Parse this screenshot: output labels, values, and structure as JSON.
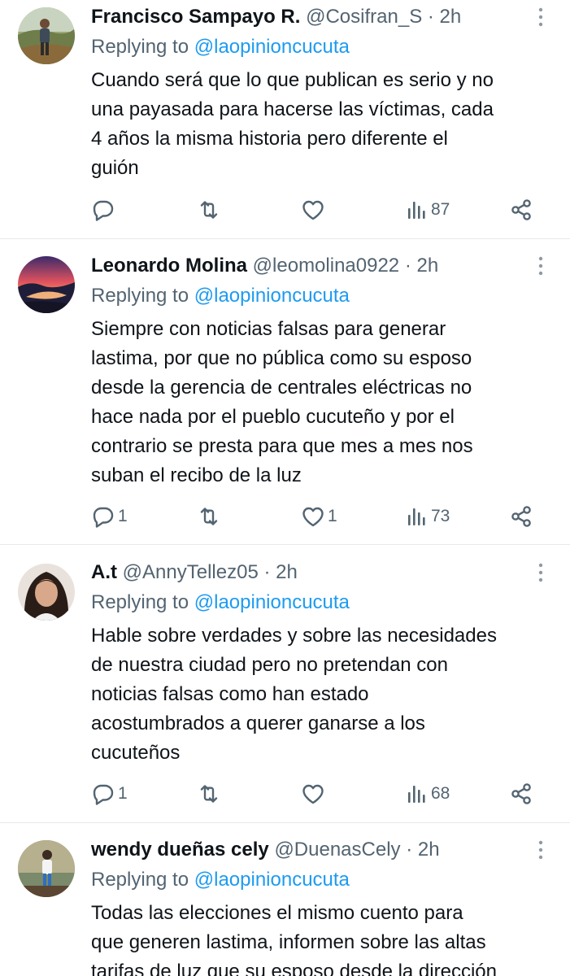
{
  "tweets": [
    {
      "name": "Francisco Sampayo R.",
      "handle": "@Cosifran_S",
      "time": "2h",
      "replying_label": "Replying to",
      "replying_to": "@laopinioncucuta",
      "lines": [
        "Cuando será que lo que publican es serio y no",
        "una payasada para hacerse las víctimas, cada",
        "4 años la misma historia pero diferente el",
        "guión"
      ],
      "reply_count": "",
      "retweet_count": "",
      "like_count": "",
      "view_count": "87",
      "avatar_icon": "profile-photo"
    },
    {
      "name": "Leonardo Molina",
      "handle": "@leomolina0922",
      "time": "2h",
      "replying_label": "Replying to",
      "replying_to": "@laopinioncucuta",
      "lines": [
        "Siempre con noticias falsas para generar",
        "lastima, por que no pública como su esposo",
        "desde la gerencia de centrales eléctricas no",
        "hace nada por el pueblo cucuteño y por el",
        "contrario se presta para que mes a  mes nos",
        "suban el recibo de la luz"
      ],
      "reply_count": "1",
      "retweet_count": "",
      "like_count": "1",
      "view_count": "73",
      "avatar_icon": "sunset-landscape-photo"
    },
    {
      "name": "A.t",
      "handle": "@AnnyTellez05",
      "time": "2h",
      "replying_label": "Replying to",
      "replying_to": "@laopinioncucuta",
      "lines": [
        "Hable sobre verdades y sobre las necesidades",
        "de nuestra ciudad pero no pretendan con",
        "noticias falsas como han estado",
        "acostumbrados a querer ganarse a los",
        "cucuteños"
      ],
      "reply_count": "1",
      "retweet_count": "",
      "like_count": "",
      "view_count": "68",
      "avatar_icon": "profile-photo"
    },
    {
      "name": "wendy dueñas cely",
      "handle": "@DuenasCely",
      "time": "2h",
      "replying_label": "Replying to",
      "replying_to": "@laopinioncucuta",
      "lines": [
        "Todas las elecciones el mismo cuento para",
        "que generen lastima, informen sobre las altas",
        "tarifas de luz que su esposo desde la dirección"
      ],
      "reply_count": "",
      "retweet_count": "",
      "like_count": "",
      "view_count": "",
      "avatar_icon": "profile-photo"
    }
  ],
  "colors": {
    "link": "#1d9bf0",
    "muted": "#536471",
    "text": "#0f1419",
    "divider": "#e6e9ec"
  }
}
